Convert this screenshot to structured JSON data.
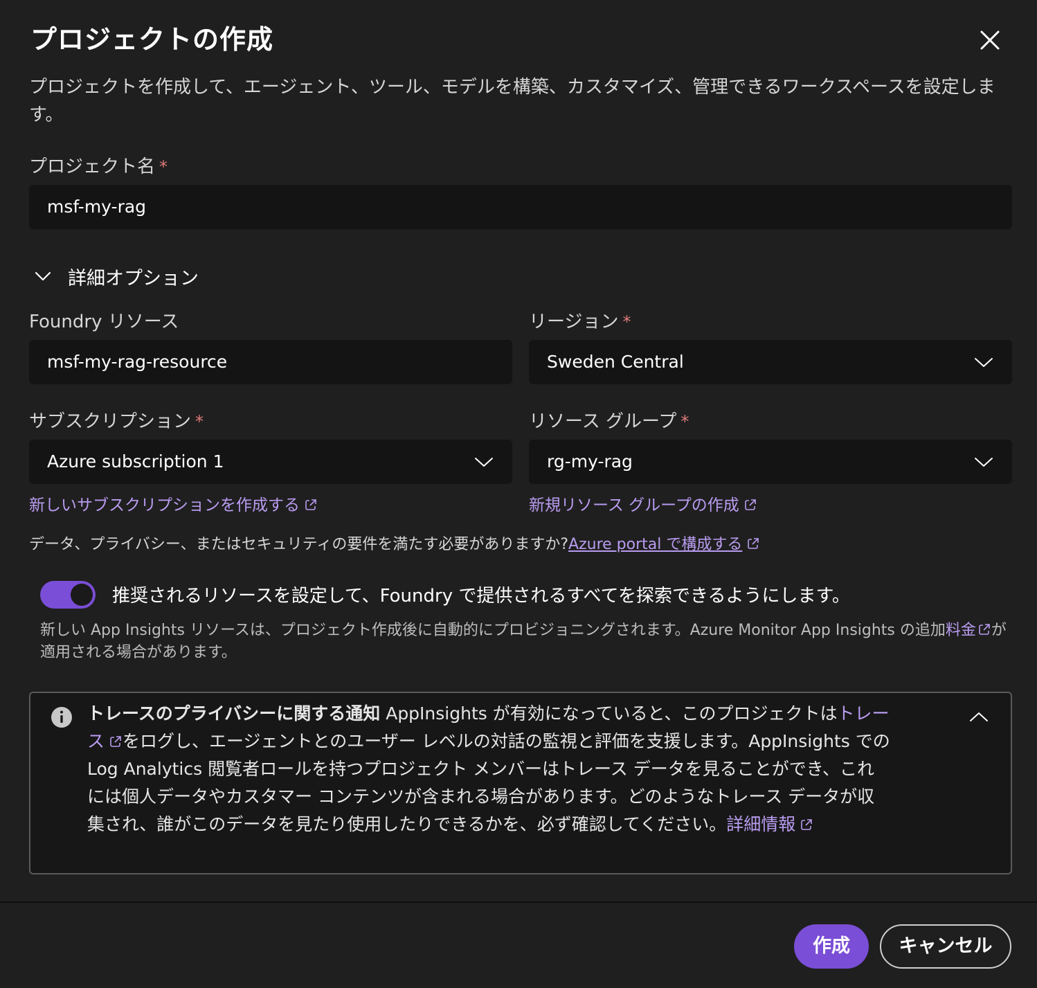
{
  "dialog": {
    "title": "プロジェクトの作成",
    "description": "プロジェクトを作成して、エージェント、ツール、モデルを構築、カスタマイズ、管理できるワークスペースを設定します。",
    "close_icon": "close-icon"
  },
  "project_name": {
    "label": "プロジェクト名",
    "required_mark": "*",
    "value": "msf-my-rag"
  },
  "advanced": {
    "label": "詳細オプション",
    "expanded": true
  },
  "foundry_resource": {
    "label": "Foundry リソース",
    "value": "msf-my-rag-resource"
  },
  "region": {
    "label": "リージョン",
    "required_mark": "*",
    "value": "Sweden Central"
  },
  "subscription": {
    "label": "サブスクリプション",
    "required_mark": "*",
    "value": "Azure subscription 1",
    "create_link": "新しいサブスクリプションを作成する"
  },
  "resource_group": {
    "label": "リソース グループ",
    "required_mark": "*",
    "value": "rg-my-rag",
    "create_link": "新規リソース グループの作成"
  },
  "privacy": {
    "question": "データ、プライバシー、またはセキュリティの要件を満たす必要がありますか?",
    "link": "Azure portal で構成する"
  },
  "toggle": {
    "on": true,
    "label": "推奨されるリソースを設定して、Foundry で提供されるすべてを探索できるようにします。",
    "note_text": "新しい App Insights リソースは、プロジェクト作成後に自動的にプロビジョニングされます。Azure Monitor App Insights の追加",
    "note_link": "料金",
    "note_tail": "が適用される場合があります。"
  },
  "notice": {
    "heading": "トレースのプライバシーに関する通知",
    "text1": " AppInsights が有効になっていると、このプロジェクトは",
    "link1": "トレース",
    "text2": "をログし、エージェントとのユーザー レベルの対話の監視と評価を支援します。AppInsights での Log Analytics 閲覧者ロールを持つプロジェクト メンバーはトレース データを見ることができ、これには個人データやカスタマー コンテンツが含まれる場合があります。どのようなトレース データが収集され、誰がこのデータを見たり使用したりできるかを、必ず確認してください。",
    "link2": "詳細情報"
  },
  "footer": {
    "create_label": "作成",
    "cancel_label": "キャンセル"
  },
  "colors": {
    "accent": "#7a4ed6",
    "link": "#b99cf0",
    "required": "#e07a7a",
    "background": "#1f1f1f",
    "input_bg": "#141414"
  }
}
